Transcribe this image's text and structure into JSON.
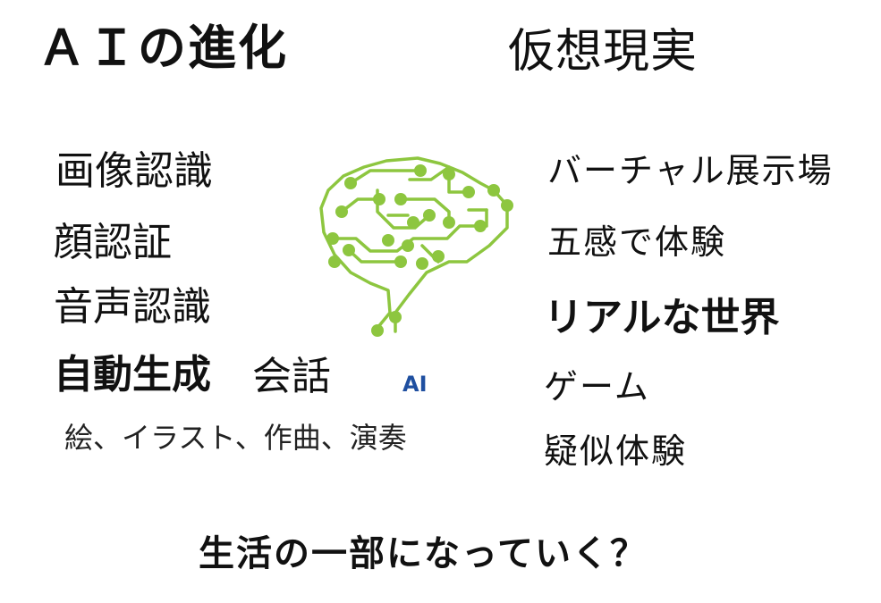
{
  "titles": {
    "ai_evolution": "ＡＩの進化",
    "virtual_reality": "仮想現実"
  },
  "left_items": {
    "image_recognition": "画像認識",
    "face_recognition": "顔認証",
    "voice_recognition": "音声認識",
    "auto_generation": "自動生成",
    "conversation": "会話",
    "examples": "絵、イラスト、作曲、演奏"
  },
  "center": {
    "ai_label": "AI",
    "brain_icon": "brain-circuit-icon"
  },
  "right_items": {
    "virtual_exhibition": "バーチャル展示場",
    "five_senses": "五感で体験",
    "real_world": "リアルな世界",
    "game": "ゲーム",
    "simulated_experience": "疑似体験"
  },
  "bottom": {
    "question": "生活の一部になっていく？"
  },
  "colors": {
    "circuit_green": "#8dc63f",
    "ai_label_blue": "#1f4fa0",
    "text": "#111111"
  }
}
